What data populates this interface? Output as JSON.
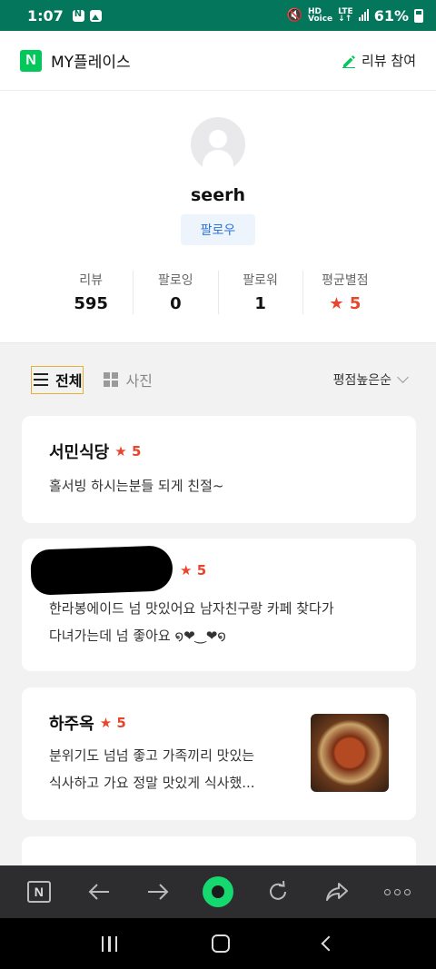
{
  "status_bar": {
    "time": "1:07",
    "network_top": "HD",
    "network_bottom": "Voice",
    "lte_top": "LTE",
    "lte_bottom": "↓↑",
    "battery": "61%"
  },
  "header": {
    "logo": "N",
    "title": "MY플레이스",
    "review_join": "리뷰 참여"
  },
  "profile": {
    "username": "seerh",
    "follow_button": "팔로우",
    "stats": [
      {
        "label": "리뷰",
        "value": "595"
      },
      {
        "label": "팔로잉",
        "value": "0"
      },
      {
        "label": "팔로워",
        "value": "1"
      },
      {
        "label": "평균별점",
        "value": "5"
      }
    ]
  },
  "tabs": {
    "all": "전체",
    "photo": "사진",
    "sort": "평점높은순"
  },
  "reviews": [
    {
      "name": "서민식당",
      "rating": "5",
      "text_lines": [
        "홀서빙 하시는분들 되게 친절~"
      ]
    },
    {
      "name": "",
      "rating": "5",
      "text_lines": [
        "한라봉에이드 넘 맛있어요 남자친구랑 카페 찾다가",
        "다녀가는데 넘 좋아요 ໑❤︎‿❤︎໑"
      ]
    },
    {
      "name": "하주옥",
      "rating": "5",
      "text_lines": [
        "분위기도 넘넘 좋고 가족끼리 맛있는",
        "식사하고 가요 정말 맛있게 식사했..."
      ]
    }
  ],
  "icons": {
    "star": "★",
    "accent_red": "#e9442c",
    "naver_green": "#03c75a",
    "status_green": "#04765b"
  }
}
